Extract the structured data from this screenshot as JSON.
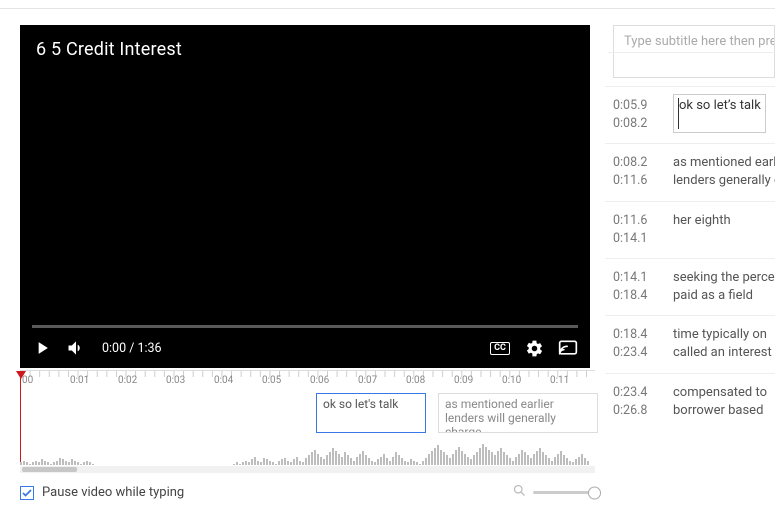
{
  "video": {
    "title": "6 5 Credit Interest",
    "current_time": "0:00",
    "duration": "1:36",
    "cc_label": "CC"
  },
  "timeline": {
    "ticks": [
      "00",
      "0:01",
      "0:02",
      "0:03",
      "0:04",
      "0:05",
      "0:06",
      "0:07",
      "0:08",
      "0:09",
      "0:10",
      "0:11"
    ],
    "active_caption_text": "ok so let's talk",
    "next_caption_text": "as mentioned earlier lenders will generally charge"
  },
  "footer": {
    "pause_label": "Pause video while typing",
    "pause_checked": true
  },
  "new_subtitle_placeholder": "Type subtitle here then press Enter",
  "subs": [
    {
      "start": "0:05.9",
      "end": "0:08.2",
      "text": "ok so let's talk",
      "editing": true
    },
    {
      "start": "0:08.2",
      "end": "0:11.6",
      "text": "as mentioned earlier lenders generally charge"
    },
    {
      "start": "0:11.6",
      "end": "0:14.1",
      "text": "her eighth"
    },
    {
      "start": "0:14.1",
      "end": "0:18.4",
      "text": "seeking the percentage is paid as a field"
    },
    {
      "start": "0:18.4",
      "end": "0:23.4",
      "text": "time typically on called an interest"
    },
    {
      "start": "0:23.4",
      "end": "0:26.8",
      "text": "compensated to borrower based"
    }
  ]
}
